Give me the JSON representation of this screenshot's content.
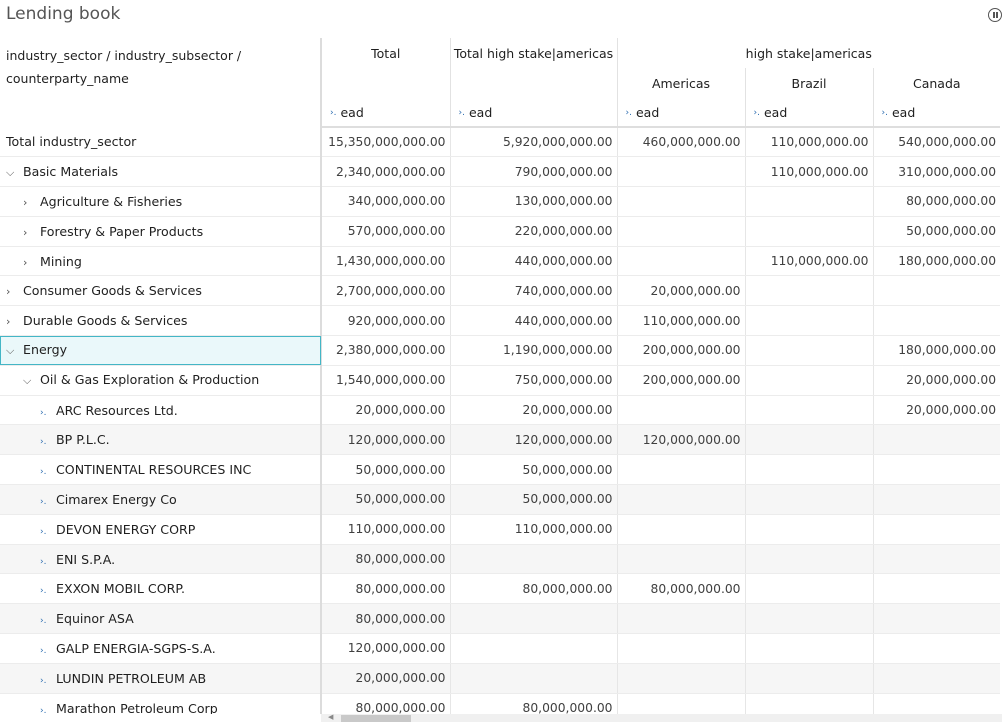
{
  "title": "Lending book",
  "header": {
    "corner_label_line1": "industry_sector / industry_subsector /",
    "corner_label_line2": "counterparty_name",
    "col_total": "Total",
    "col_total_high_stake": "Total high stake|americas",
    "group_high_stake": "high stake|americas",
    "col_americas": "Americas",
    "col_brazil": "Brazil",
    "col_canada": "Canada",
    "measure": "ead"
  },
  "rows": [
    {
      "label": "Total industry_sector",
      "total": "15,350,000,000.00",
      "high": "5,920,000,000.00",
      "americas": "460,000,000.00",
      "brazil": "110,000,000.00",
      "canada": "540,000,000.00"
    },
    {
      "label": "Basic Materials",
      "total": "2,340,000,000.00",
      "high": "790,000,000.00",
      "americas": "",
      "brazil": "110,000,000.00",
      "canada": "310,000,000.00"
    },
    {
      "label": "Agriculture & Fisheries",
      "total": "340,000,000.00",
      "high": "130,000,000.00",
      "americas": "",
      "brazil": "",
      "canada": "80,000,000.00"
    },
    {
      "label": "Forestry & Paper Products",
      "total": "570,000,000.00",
      "high": "220,000,000.00",
      "americas": "",
      "brazil": "",
      "canada": "50,000,000.00"
    },
    {
      "label": "Mining",
      "total": "1,430,000,000.00",
      "high": "440,000,000.00",
      "americas": "",
      "brazil": "110,000,000.00",
      "canada": "180,000,000.00"
    },
    {
      "label": "Consumer Goods & Services",
      "total": "2,700,000,000.00",
      "high": "740,000,000.00",
      "americas": "20,000,000.00",
      "brazil": "",
      "canada": ""
    },
    {
      "label": "Durable Goods & Services",
      "total": "920,000,000.00",
      "high": "440,000,000.00",
      "americas": "110,000,000.00",
      "brazil": "",
      "canada": ""
    },
    {
      "label": "Energy",
      "total": "2,380,000,000.00",
      "high": "1,190,000,000.00",
      "americas": "200,000,000.00",
      "brazil": "",
      "canada": "180,000,000.00"
    },
    {
      "label": "Oil & Gas Exploration & Production",
      "total": "1,540,000,000.00",
      "high": "750,000,000.00",
      "americas": "200,000,000.00",
      "brazil": "",
      "canada": "20,000,000.00"
    },
    {
      "label": "ARC Resources Ltd.",
      "total": "20,000,000.00",
      "high": "20,000,000.00",
      "americas": "",
      "brazil": "",
      "canada": "20,000,000.00"
    },
    {
      "label": "BP P.L.C.",
      "total": "120,000,000.00",
      "high": "120,000,000.00",
      "americas": "120,000,000.00",
      "brazil": "",
      "canada": ""
    },
    {
      "label": "CONTINENTAL RESOURCES INC",
      "total": "50,000,000.00",
      "high": "50,000,000.00",
      "americas": "",
      "brazil": "",
      "canada": ""
    },
    {
      "label": "Cimarex Energy Co",
      "total": "50,000,000.00",
      "high": "50,000,000.00",
      "americas": "",
      "brazil": "",
      "canada": ""
    },
    {
      "label": "DEVON ENERGY CORP",
      "total": "110,000,000.00",
      "high": "110,000,000.00",
      "americas": "",
      "brazil": "",
      "canada": ""
    },
    {
      "label": "ENI S.P.A.",
      "total": "80,000,000.00",
      "high": "",
      "americas": "",
      "brazil": "",
      "canada": ""
    },
    {
      "label": "EXXON MOBIL CORP.",
      "total": "80,000,000.00",
      "high": "80,000,000.00",
      "americas": "80,000,000.00",
      "brazil": "",
      "canada": ""
    },
    {
      "label": "Equinor ASA",
      "total": "80,000,000.00",
      "high": "",
      "americas": "",
      "brazil": "",
      "canada": ""
    },
    {
      "label": "GALP ENERGIA-SGPS-S.A.",
      "total": "120,000,000.00",
      "high": "",
      "americas": "",
      "brazil": "",
      "canada": ""
    },
    {
      "label": "LUNDIN PETROLEUM AB",
      "total": "20,000,000.00",
      "high": "",
      "americas": "",
      "brazil": "",
      "canada": ""
    },
    {
      "label": "Marathon Petroleum Corp",
      "total": "80,000,000.00",
      "high": "80,000,000.00",
      "americas": "",
      "brazil": "",
      "canada": ""
    }
  ],
  "icons": {
    "expanded": "chevron-down-icon",
    "collapsed": "chevron-right-icon",
    "member": "member-expand-icon",
    "pause": "pause-icon"
  },
  "colors": {
    "selected_border": "#43b6c6",
    "selected_bg": "#eaf8fa",
    "measure_icon": "#2b6cb0",
    "alt_row_bg": "#f6f6f6"
  }
}
